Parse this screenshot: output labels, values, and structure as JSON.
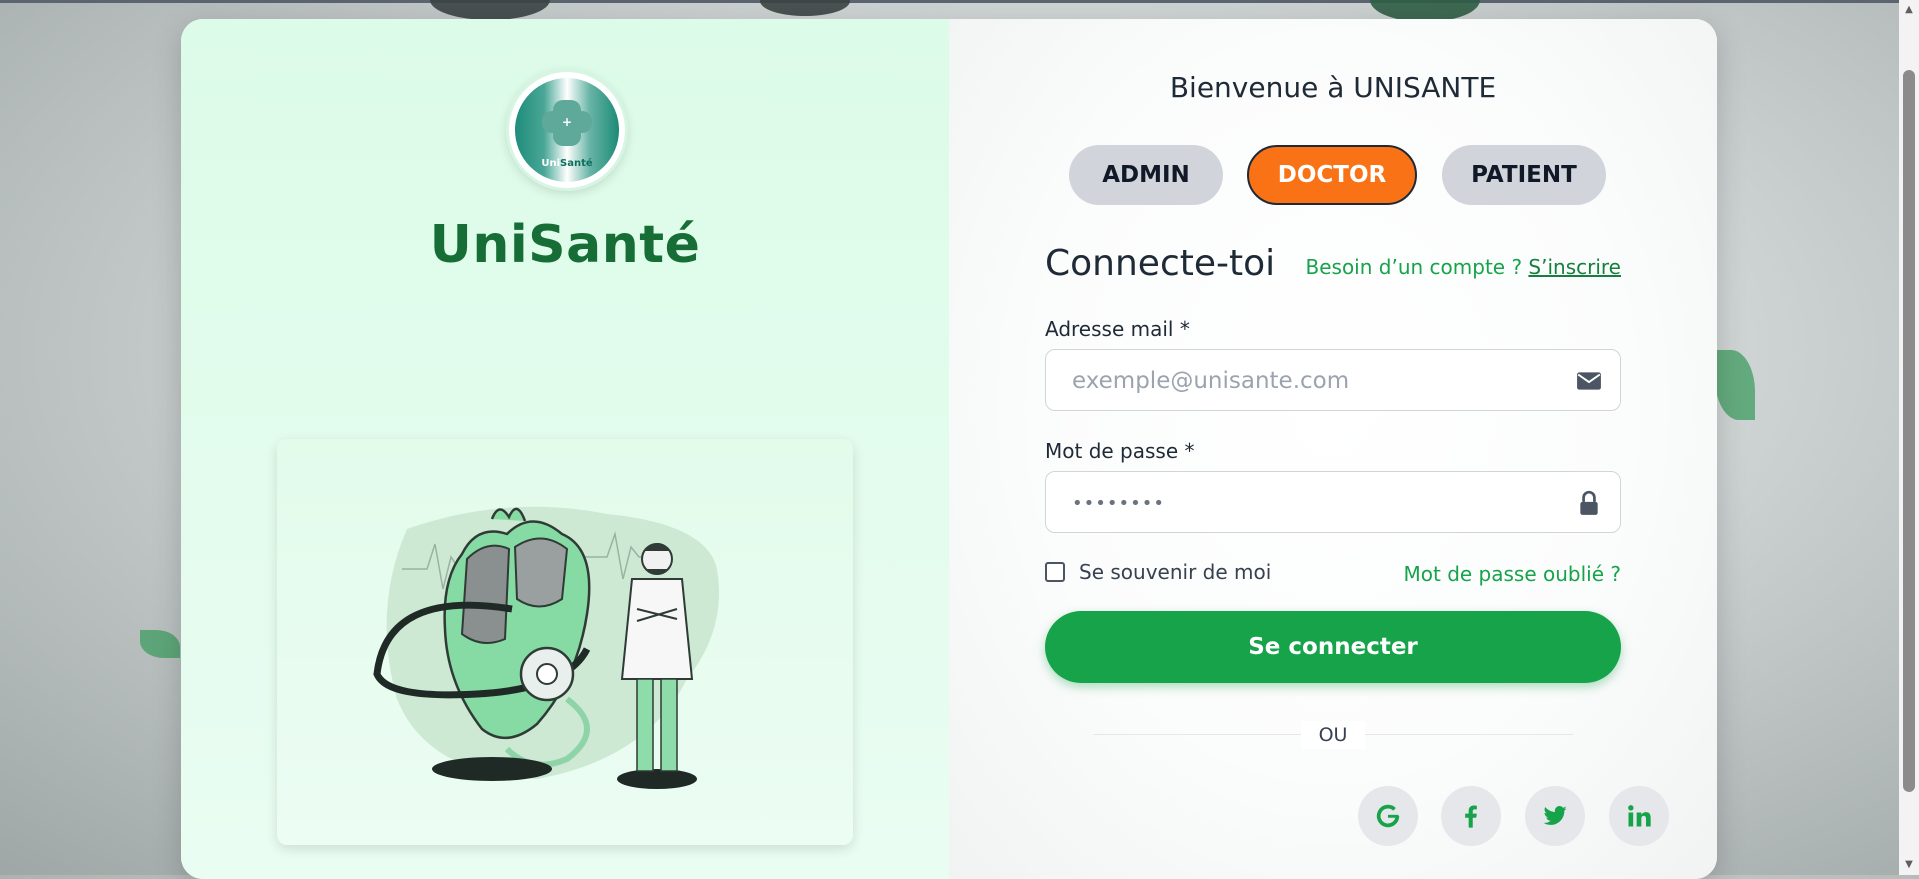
{
  "brand": {
    "logo_text_a": "Uni",
    "logo_text_b": "Santé",
    "name": "UniSanté"
  },
  "login": {
    "welcome": "Bienvenue à UNISANTE",
    "roles": [
      {
        "label": "ADMIN",
        "active": false
      },
      {
        "label": "DOCTOR",
        "active": true
      },
      {
        "label": "PATIENT",
        "active": false
      }
    ],
    "title": "Connecte-toi",
    "need_account": "Besoin d’un compte ?",
    "signup_link": "S’inscrire",
    "email_label": "Adresse mail *",
    "email_placeholder": "exemple@unisante.com",
    "password_label": "Mot de passe *",
    "password_value": "••••••••",
    "remember_label": "Se souvenir de moi",
    "forgot_link": "Mot de passe oublié ?",
    "submit_label": "Se connecter",
    "or_text": "OU",
    "social": [
      "google-icon",
      "facebook-icon",
      "twitter-icon",
      "linkedin-icon"
    ]
  },
  "colors": {
    "primary_green": "#16a34a",
    "brand_green": "#166d36",
    "active_role": "#f97316",
    "inactive_role": "#d1d5db"
  }
}
